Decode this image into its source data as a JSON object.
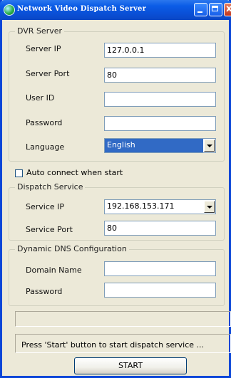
{
  "window": {
    "title": "Network Video Dispatch Server"
  },
  "dvr_server": {
    "group_title": "DVR Server",
    "server_ip_label": "Server IP",
    "server_ip_value": "127.0.0.1",
    "server_port_label": "Server Port",
    "server_port_value": "80",
    "user_id_label": "User ID",
    "user_id_value": "",
    "password_label": "Password",
    "password_value": "",
    "language_label": "Language",
    "language_value": "English"
  },
  "auto_connect": {
    "label": "Auto connect when start",
    "checked": false
  },
  "dispatch_service": {
    "group_title": "Dispatch Service",
    "service_ip_label": "Service IP",
    "service_ip_value": "192.168.153.171",
    "service_port_label": "Service Port",
    "service_port_value": "80"
  },
  "ddns": {
    "group_title": "Dynamic DNS Configuration",
    "domain_name_label": "Domain Name",
    "domain_name_value": "",
    "password_label": "Password",
    "password_value": ""
  },
  "status": {
    "message": "Press 'Start' button to start dispatch service ..."
  },
  "actions": {
    "start_label": "START"
  },
  "icons": {
    "app": "app-globe-icon",
    "minimize": "minimize-icon",
    "maximize": "maximize-icon",
    "close": "close-icon",
    "dropdown": "chevron-down-icon"
  }
}
